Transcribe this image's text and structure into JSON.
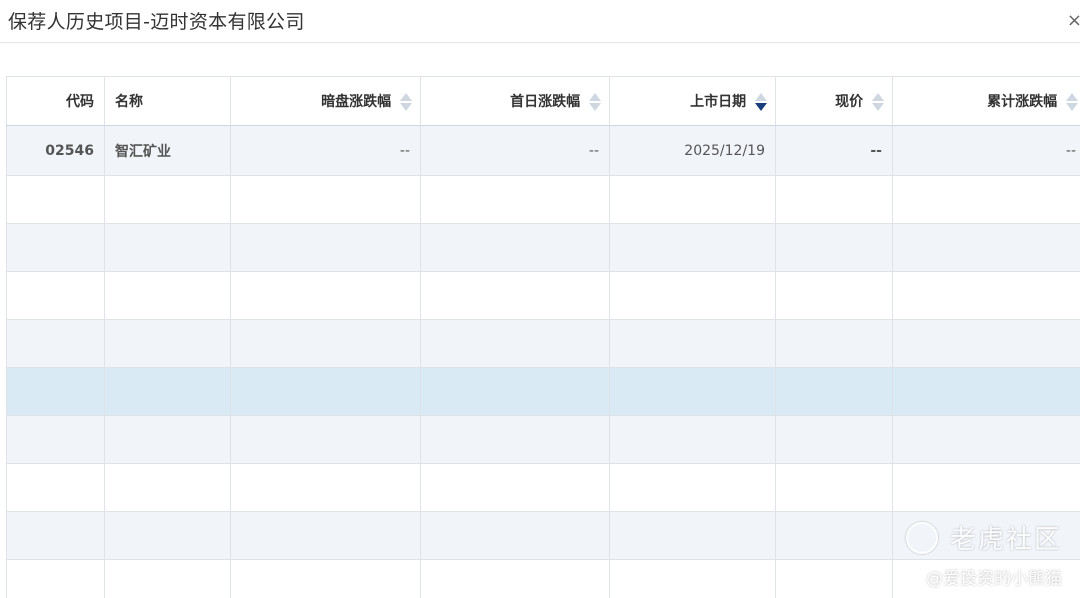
{
  "dialog": {
    "title": "保荐人历史项目-迈时资本有限公司",
    "close_label": "×"
  },
  "table": {
    "columns": [
      {
        "key": "code",
        "label": "代码",
        "align": "right",
        "sortable": false
      },
      {
        "key": "name",
        "label": "名称",
        "align": "left",
        "sortable": false
      },
      {
        "key": "grey_change",
        "label": "暗盘涨跌幅",
        "align": "right",
        "sortable": true,
        "sort": "none"
      },
      {
        "key": "first_day_change",
        "label": "首日涨跌幅",
        "align": "right",
        "sortable": true,
        "sort": "none"
      },
      {
        "key": "listing_date",
        "label": "上市日期",
        "align": "right",
        "sortable": true,
        "sort": "desc"
      },
      {
        "key": "price",
        "label": "现价",
        "align": "right",
        "sortable": true,
        "sort": "none"
      },
      {
        "key": "cum_change",
        "label": "累计涨跌幅",
        "align": "right",
        "sortable": true,
        "sort": "none"
      }
    ],
    "rows": [
      {
        "code": "02546",
        "name": "智汇矿业",
        "grey_change": "--",
        "first_day_change": "--",
        "listing_date": "2025/12/19",
        "price": "--",
        "cum_change": "--"
      }
    ],
    "empty_row_count": 9
  },
  "watermark": {
    "brand": "老虎社区",
    "handle": "@爱投资的小熊猫",
    "logo_icon": "tiger-logo-icon"
  },
  "colors": {
    "link": "#1a3d7c",
    "row_alt": "#f1f5f9",
    "row_selected": "#daeaf4",
    "border": "#dfe3e8"
  }
}
